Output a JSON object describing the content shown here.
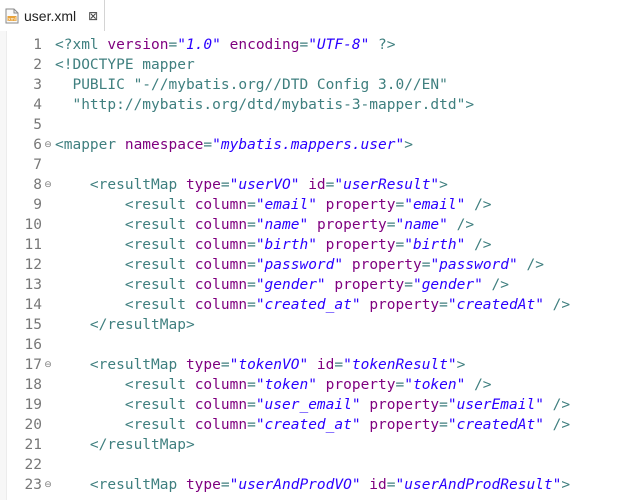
{
  "tab": {
    "file_name": "user.xml",
    "close_symbol": "⊠"
  },
  "fold_symbol": "⊖",
  "lines": [
    {
      "num": "1",
      "fold": false,
      "parts": [
        [
          "t",
          "<?xml "
        ],
        [
          "a",
          "version"
        ],
        [
          "t",
          "="
        ],
        [
          "s",
          "\"1.0\""
        ],
        [
          "t",
          " "
        ],
        [
          "a",
          "encoding"
        ],
        [
          "t",
          "="
        ],
        [
          "s",
          "\"UTF-8\""
        ],
        [
          "t",
          " ?>"
        ]
      ]
    },
    {
      "num": "2",
      "fold": false,
      "parts": [
        [
          "t",
          "<!DOCTYPE mapper"
        ]
      ]
    },
    {
      "num": "3",
      "fold": false,
      "parts": [
        [
          "t",
          "  PUBLIC "
        ],
        [
          "d",
          "\"-//mybatis.org//DTD Config 3.0//EN\""
        ]
      ]
    },
    {
      "num": "4",
      "fold": false,
      "parts": [
        [
          "t",
          "  "
        ],
        [
          "d",
          "\"http://mybatis.org/dtd/mybatis-3-mapper.dtd\""
        ],
        [
          "t",
          ">"
        ]
      ]
    },
    {
      "num": "5",
      "fold": false,
      "parts": []
    },
    {
      "num": "6",
      "fold": true,
      "parts": [
        [
          "t",
          "<mapper "
        ],
        [
          "a",
          "namespace"
        ],
        [
          "t",
          "="
        ],
        [
          "s",
          "\"mybatis.mappers.user\""
        ],
        [
          "t",
          ">"
        ]
      ]
    },
    {
      "num": "7",
      "fold": false,
      "parts": []
    },
    {
      "num": "8",
      "fold": true,
      "parts": [
        [
          "t",
          "    <resultMap "
        ],
        [
          "a",
          "type"
        ],
        [
          "t",
          "="
        ],
        [
          "s",
          "\"userVO\""
        ],
        [
          "t",
          " "
        ],
        [
          "a",
          "id"
        ],
        [
          "t",
          "="
        ],
        [
          "s",
          "\"userResult\""
        ],
        [
          "t",
          ">"
        ]
      ]
    },
    {
      "num": "9",
      "fold": false,
      "parts": [
        [
          "t",
          "        <result "
        ],
        [
          "a",
          "column"
        ],
        [
          "t",
          "="
        ],
        [
          "s",
          "\"email\""
        ],
        [
          "t",
          " "
        ],
        [
          "a",
          "property"
        ],
        [
          "t",
          "="
        ],
        [
          "s",
          "\"email\""
        ],
        [
          "t",
          " />"
        ]
      ]
    },
    {
      "num": "10",
      "fold": false,
      "parts": [
        [
          "t",
          "        <result "
        ],
        [
          "a",
          "column"
        ],
        [
          "t",
          "="
        ],
        [
          "s",
          "\"name\""
        ],
        [
          "t",
          " "
        ],
        [
          "a",
          "property"
        ],
        [
          "t",
          "="
        ],
        [
          "s",
          "\"name\""
        ],
        [
          "t",
          " />"
        ]
      ]
    },
    {
      "num": "11",
      "fold": false,
      "parts": [
        [
          "t",
          "        <result "
        ],
        [
          "a",
          "column"
        ],
        [
          "t",
          "="
        ],
        [
          "s",
          "\"birth\""
        ],
        [
          "t",
          " "
        ],
        [
          "a",
          "property"
        ],
        [
          "t",
          "="
        ],
        [
          "s",
          "\"birth\""
        ],
        [
          "t",
          " />"
        ]
      ]
    },
    {
      "num": "12",
      "fold": false,
      "parts": [
        [
          "t",
          "        <result "
        ],
        [
          "a",
          "column"
        ],
        [
          "t",
          "="
        ],
        [
          "s",
          "\"password\""
        ],
        [
          "t",
          " "
        ],
        [
          "a",
          "property"
        ],
        [
          "t",
          "="
        ],
        [
          "s",
          "\"password\""
        ],
        [
          "t",
          " />"
        ]
      ]
    },
    {
      "num": "13",
      "fold": false,
      "parts": [
        [
          "t",
          "        <result "
        ],
        [
          "a",
          "column"
        ],
        [
          "t",
          "="
        ],
        [
          "s",
          "\"gender\""
        ],
        [
          "t",
          " "
        ],
        [
          "a",
          "property"
        ],
        [
          "t",
          "="
        ],
        [
          "s",
          "\"gender\""
        ],
        [
          "t",
          " />"
        ]
      ]
    },
    {
      "num": "14",
      "fold": false,
      "parts": [
        [
          "t",
          "        <result "
        ],
        [
          "a",
          "column"
        ],
        [
          "t",
          "="
        ],
        [
          "s",
          "\"created_at\""
        ],
        [
          "t",
          " "
        ],
        [
          "a",
          "property"
        ],
        [
          "t",
          "="
        ],
        [
          "s",
          "\"createdAt\""
        ],
        [
          "t",
          " />"
        ]
      ]
    },
    {
      "num": "15",
      "fold": false,
      "parts": [
        [
          "t",
          "    </resultMap>"
        ]
      ]
    },
    {
      "num": "16",
      "fold": false,
      "parts": []
    },
    {
      "num": "17",
      "fold": true,
      "parts": [
        [
          "t",
          "    <resultMap "
        ],
        [
          "a",
          "type"
        ],
        [
          "t",
          "="
        ],
        [
          "s",
          "\"tokenVO\""
        ],
        [
          "t",
          " "
        ],
        [
          "a",
          "id"
        ],
        [
          "t",
          "="
        ],
        [
          "s",
          "\"tokenResult\""
        ],
        [
          "t",
          ">"
        ]
      ]
    },
    {
      "num": "18",
      "fold": false,
      "parts": [
        [
          "t",
          "        <result "
        ],
        [
          "a",
          "column"
        ],
        [
          "t",
          "="
        ],
        [
          "s",
          "\"token\""
        ],
        [
          "t",
          " "
        ],
        [
          "a",
          "property"
        ],
        [
          "t",
          "="
        ],
        [
          "s",
          "\"token\""
        ],
        [
          "t",
          " />"
        ]
      ]
    },
    {
      "num": "19",
      "fold": false,
      "parts": [
        [
          "t",
          "        <result "
        ],
        [
          "a",
          "column"
        ],
        [
          "t",
          "="
        ],
        [
          "s",
          "\"user_email\""
        ],
        [
          "t",
          " "
        ],
        [
          "a",
          "property"
        ],
        [
          "t",
          "="
        ],
        [
          "s",
          "\"userEmail\""
        ],
        [
          "t",
          " />"
        ]
      ]
    },
    {
      "num": "20",
      "fold": false,
      "parts": [
        [
          "t",
          "        <result "
        ],
        [
          "a",
          "column"
        ],
        [
          "t",
          "="
        ],
        [
          "s",
          "\"created_at\""
        ],
        [
          "t",
          " "
        ],
        [
          "a",
          "property"
        ],
        [
          "t",
          "="
        ],
        [
          "s",
          "\"createdAt\""
        ],
        [
          "t",
          " />"
        ]
      ]
    },
    {
      "num": "21",
      "fold": false,
      "parts": [
        [
          "t",
          "    </resultMap>"
        ]
      ]
    },
    {
      "num": "22",
      "fold": false,
      "parts": []
    },
    {
      "num": "23",
      "fold": true,
      "parts": [
        [
          "t",
          "    <resultMap "
        ],
        [
          "a",
          "type"
        ],
        [
          "t",
          "="
        ],
        [
          "s",
          "\"userAndProdVO\""
        ],
        [
          "t",
          " "
        ],
        [
          "a",
          "id"
        ],
        [
          "t",
          "="
        ],
        [
          "s",
          "\"userAndProdResult\""
        ],
        [
          "t",
          ">"
        ]
      ]
    }
  ]
}
